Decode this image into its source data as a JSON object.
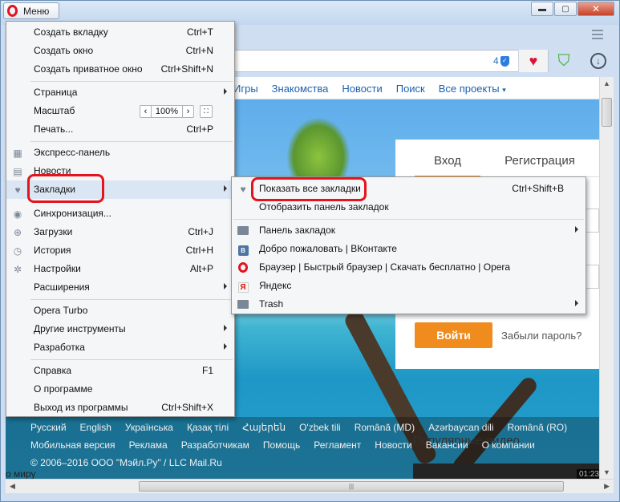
{
  "titlebar": {
    "menu_label": "Меню",
    "minimize": "▬",
    "maximize": "▢",
    "close": "✕"
  },
  "addressbar": {
    "blocked_count": "4"
  },
  "nav": {
    "links": [
      "Игры",
      "Знакомства",
      "Новости",
      "Поиск",
      "Все проекты"
    ],
    "all_projects_caret": "▾"
  },
  "login": {
    "tab_login": "Вход",
    "tab_register": "Регистрация",
    "submit": "Войти",
    "forgot": "Забыли пароль?"
  },
  "footer": {
    "languages": [
      "Русский",
      "English",
      "Українська",
      "Қазақ тілі",
      "Հայերեն",
      "O'zbek tili",
      "Română (MD)",
      "Azərbaycan dili",
      "Română (RO)"
    ],
    "links": [
      "Мобильная версия",
      "Реклама",
      "Разработчикам",
      "Помощь",
      "Регламент",
      "Новости",
      "Вакансии",
      "О компании"
    ],
    "copyright": "© 2006–2016 ООО \"Мэйл.Ру\" / LLC Mail.Ru"
  },
  "page": {
    "popular_video": "Популярные видео",
    "video_time": "01:23",
    "world_text": "о миру"
  },
  "main_menu": {
    "items": [
      {
        "label": "Создать вкладку",
        "shortcut": "Ctrl+T"
      },
      {
        "label": "Создать окно",
        "shortcut": "Ctrl+N"
      },
      {
        "label": "Создать приватное окно",
        "shortcut": "Ctrl+Shift+N"
      },
      {
        "label": "Страница",
        "shortcut": ""
      },
      {
        "label": "Масштаб",
        "shortcut": ""
      },
      {
        "label": "Печать...",
        "shortcut": "Ctrl+P"
      },
      {
        "label": "Экспресс-панель",
        "shortcut": ""
      },
      {
        "label": "Новости",
        "shortcut": ""
      },
      {
        "label": "Закладки",
        "shortcut": ""
      },
      {
        "label": "Синхронизация...",
        "shortcut": ""
      },
      {
        "label": "Загрузки",
        "shortcut": "Ctrl+J"
      },
      {
        "label": "История",
        "shortcut": "Ctrl+H"
      },
      {
        "label": "Настройки",
        "shortcut": "Alt+P"
      },
      {
        "label": "Расширения",
        "shortcut": ""
      },
      {
        "label": "Opera Turbo",
        "shortcut": ""
      },
      {
        "label": "Другие инструменты",
        "shortcut": ""
      },
      {
        "label": "Разработка",
        "shortcut": ""
      },
      {
        "label": "Справка",
        "shortcut": "F1"
      },
      {
        "label": "О программе",
        "shortcut": ""
      },
      {
        "label": "Выход из программы",
        "shortcut": "Ctrl+Shift+X"
      }
    ],
    "zoom": {
      "value": "100%",
      "minus": "‹",
      "plus": "›",
      "fullscreen": "⛶"
    }
  },
  "bookmarks_menu": {
    "items": [
      {
        "label": "Показать все закладки",
        "shortcut": "Ctrl+Shift+B"
      },
      {
        "label": "Отобразить панель закладок",
        "shortcut": ""
      },
      {
        "label": "Панель закладок",
        "shortcut": ""
      },
      {
        "label": "Добро пожаловать | ВКонтакте",
        "shortcut": ""
      },
      {
        "label": "Браузер | Быстрый браузер | Скачать бесплатно | Opera",
        "shortcut": ""
      },
      {
        "label": "Яндекс",
        "shortcut": ""
      },
      {
        "label": "Trash",
        "shortcut": ""
      }
    ]
  },
  "colors": {
    "accent": "#f08c1e",
    "highlight_ring": "#e4141e",
    "link": "#1a60b0"
  }
}
